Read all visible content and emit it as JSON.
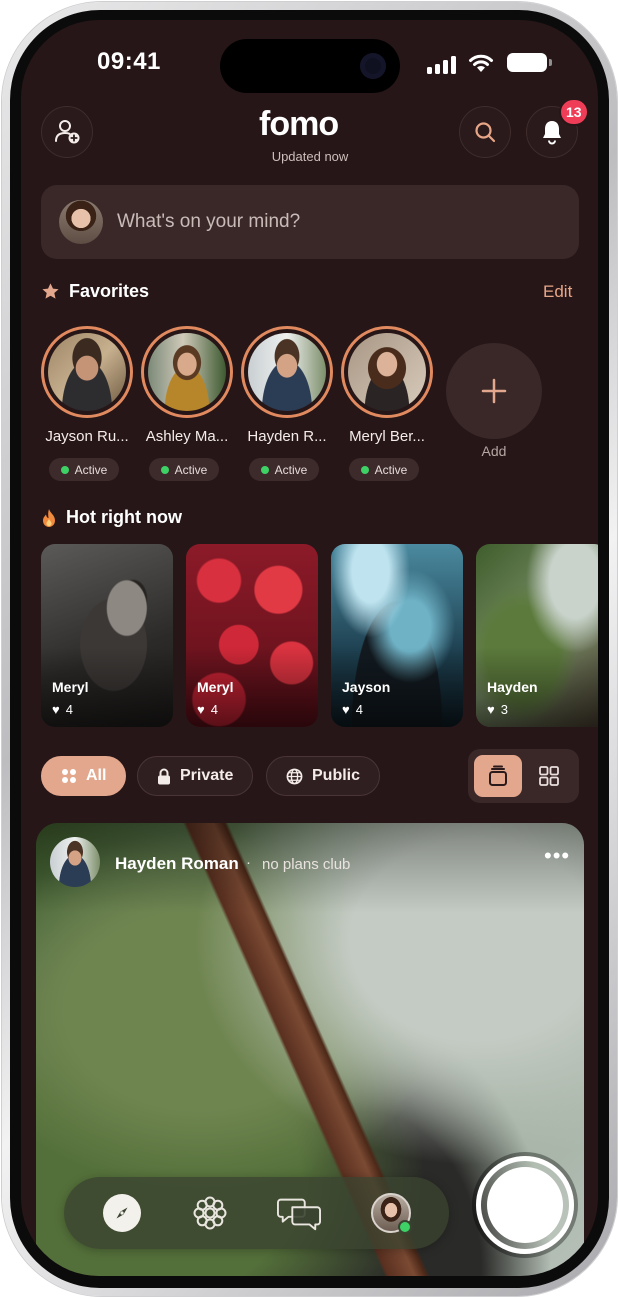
{
  "status_bar": {
    "time": "09:41"
  },
  "header": {
    "brand": "fomo",
    "subtitle": "Updated now",
    "notification_count": "13"
  },
  "composer": {
    "placeholder": "What's on your mind?"
  },
  "favorites": {
    "title": "Favorites",
    "edit_label": "Edit",
    "add_label": "Add",
    "items": [
      {
        "name": "Jayson Ru...",
        "status": "Active"
      },
      {
        "name": "Ashley Ma...",
        "status": "Active"
      },
      {
        "name": "Hayden R...",
        "status": "Active"
      },
      {
        "name": "Meryl Ber...",
        "status": "Active"
      }
    ]
  },
  "hot": {
    "title": "Hot right now",
    "items": [
      {
        "name": "Meryl",
        "likes": "4"
      },
      {
        "name": "Meryl",
        "likes": "4"
      },
      {
        "name": "Jayson",
        "likes": "4"
      },
      {
        "name": "Hayden",
        "likes": "3"
      }
    ]
  },
  "filters": {
    "all": "All",
    "private": "Private",
    "public": "Public"
  },
  "post": {
    "author": "Hayden Roman",
    "separator": "·",
    "group": "no plans club",
    "more": "•••"
  },
  "tab_bar": {
    "icons": [
      "compass-icon",
      "flower-icon",
      "chat-bubbles-icon",
      "profile-avatar"
    ]
  },
  "colors": {
    "background": "#261617",
    "accent": "#e3a78d",
    "ring": "#e28a5f",
    "badge": "#ef3d58",
    "active_dot": "#3ed166"
  }
}
